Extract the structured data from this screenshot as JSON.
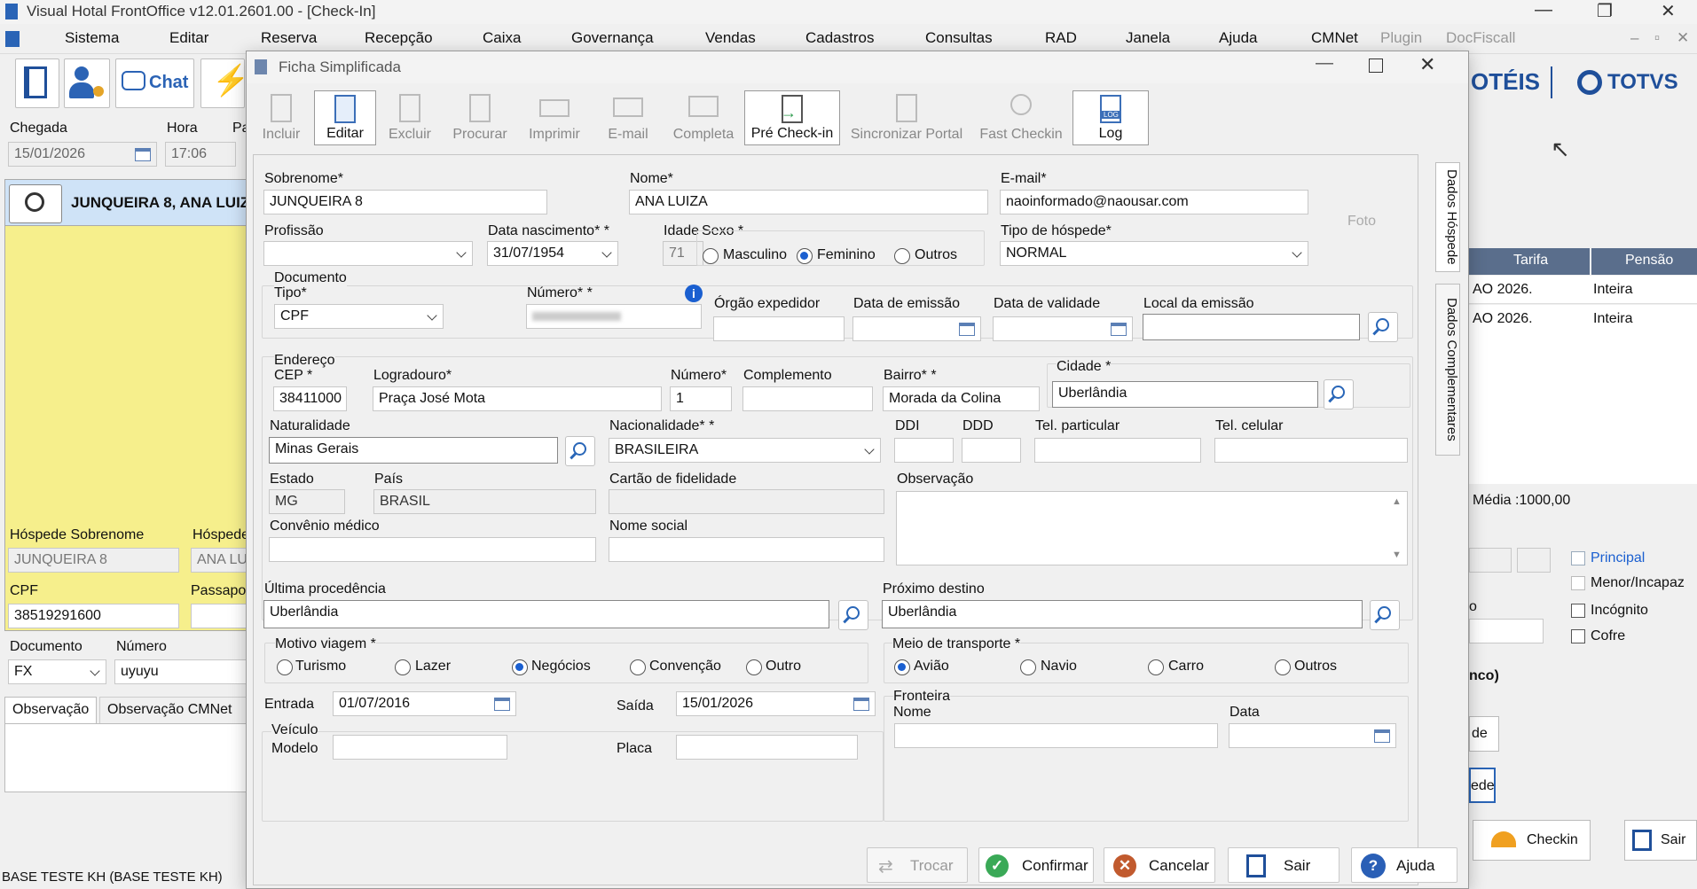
{
  "app": {
    "title": "Visual Hotal FrontOffice v12.01.2601.00 - [Check-In]",
    "controls": [
      "—",
      "❐",
      "✕"
    ]
  },
  "menu": [
    "Sistema",
    "Editar",
    "Reserva",
    "Recepção",
    "Caixa",
    "Governança",
    "Vendas",
    "Cadastros",
    "Consultas",
    "RAD",
    "Janela",
    "Ajuda",
    "CMNet",
    "Plugin",
    "DocFiscall"
  ],
  "toolbar": {
    "chat_label": "Chat"
  },
  "brand": {
    "hotels": "OTÉIS",
    "totvs": "TOTVS"
  },
  "left": {
    "chegada_label": "Chegada",
    "chegada_value": "15/01/2026",
    "hora_label": "Hora",
    "hora_value": "17:06",
    "pa_label": "Pa",
    "guest_name": "JUNQUEIRA 8, ANA LUIZA",
    "sobrenome_label": "Hóspede Sobrenome",
    "sobrenome_value": "JUNQUEIRA 8",
    "hospede_label": "Hóspede",
    "hospede_value": "ANA LU",
    "cpf_label": "CPF",
    "cpf_value": "38519291600",
    "passaporte_label": "Passapo",
    "documento_label": "Documento",
    "documento_value": "FX",
    "numero_label": "Número",
    "numero_value": "uyuyu",
    "tab_obs": "Observação",
    "tab_obs_cmnet": "Observação CMNet",
    "status": "BASE TESTE KH (BASE TESTE KH)"
  },
  "right": {
    "tarifa_header": "Tarifa",
    "pensao_header": "Pensão",
    "rows": [
      {
        "tarifa": "AO 2026.",
        "pensao": "Inteira"
      },
      {
        "tarifa": "AO 2026.",
        "pensao": "Inteira"
      }
    ],
    "media": "Média :1000,00",
    "principal": "Principal",
    "menor": "Menor/Incapaz",
    "incognito": "Incógnito",
    "cofre": "Cofre",
    "o_label": "o",
    "nco": "nco)",
    "de1": "de",
    "de2": "ede",
    "checkin": "Checkin",
    "sair": "Sair"
  },
  "dialog": {
    "title": "Ficha Simplificada",
    "ribbon": [
      "Incluir",
      "Editar",
      "Excluir",
      "Procurar",
      "Imprimir",
      "E-mail",
      "Completa",
      "Pré Check-in",
      "Sincronizar Portal",
      "Fast Checkin",
      "Log"
    ],
    "log_badge": "LOG",
    "tabs": {
      "dados_hospede": "Dados Hóspede",
      "dados_complementares": "Dados Complementares"
    },
    "foto": "Foto",
    "sobrenome": {
      "label": "Sobrenome*",
      "value": "JUNQUEIRA 8"
    },
    "nome": {
      "label": "Nome*",
      "value": "ANA LUIZA"
    },
    "email": {
      "label": "E-mail*",
      "value": "naoinformado@naousar.com"
    },
    "profissao": {
      "label": "Profissão",
      "value": ""
    },
    "nascimento": {
      "label": "Data nascimento* *",
      "value": "31/07/1954"
    },
    "idade": {
      "label": "Idade",
      "value": "71"
    },
    "sexo": {
      "label": "Sexo *",
      "options": [
        "Masculino",
        "Feminino",
        "Outros"
      ],
      "selected": "Feminino"
    },
    "tipo_hospede": {
      "label": "Tipo de hóspede*",
      "value": "NORMAL"
    },
    "documento": {
      "group": "Documento",
      "tipo_label": "Tipo*",
      "tipo_value": "CPF",
      "numero_label": "Número* *",
      "orgao_label": "Órgão expedidor",
      "emissao_label": "Data de emissão",
      "validade_label": "Data de validade",
      "local_label": "Local da emissão"
    },
    "endereco": {
      "group": "Endereço",
      "cep_label": "CEP *",
      "cep_value": "38411000",
      "logradouro_label": "Logradouro*",
      "logradouro_value": "Praça José Mota",
      "numero_label": "Número*",
      "numero_value": "1",
      "complemento_label": "Complemento",
      "bairro_label": "Bairro* *",
      "bairro_value": "Morada da Colina",
      "cidade_label": "Cidade *",
      "cidade_value": "Uberlândia",
      "naturalidade_label": "Naturalidade",
      "naturalidade_value": "Minas Gerais",
      "nacionalidade_label": "Nacionalidade* *",
      "nacionalidade_value": "BRASILEIRA",
      "ddi_label": "DDI",
      "ddd_label": "DDD",
      "tel_part_label": "Tel. particular",
      "tel_cel_label": "Tel. celular",
      "estado_label": "Estado",
      "estado_value": "MG",
      "pais_label": "País",
      "pais_value": "BRASIL",
      "fidelidade_label": "Cartão de fidelidade",
      "observacao_label": "Observação",
      "convenio_label": "Convênio médico",
      "nome_social_label": "Nome social"
    },
    "ultima_procedencia": {
      "label": "Última procedência",
      "value": "Uberlândia"
    },
    "proximo_destino": {
      "label": "Próximo destino",
      "value": "Uberlândia"
    },
    "motivo": {
      "label": "Motivo viagem *",
      "options": [
        "Turismo",
        "Lazer",
        "Negócios",
        "Convenção",
        "Outro"
      ],
      "selected": "Negócios"
    },
    "transporte": {
      "label": "Meio de transporte *",
      "options": [
        "Avião",
        "Navio",
        "Carro",
        "Outros"
      ],
      "selected": "Avião"
    },
    "entrada": {
      "label": "Entrada",
      "value": "01/07/2016"
    },
    "saida": {
      "label": "Saída",
      "value": "15/01/2026"
    },
    "veiculo": {
      "group": "Veículo",
      "modelo_label": "Modelo",
      "placa_label": "Placa"
    },
    "fronteira": {
      "group": "Fronteira",
      "nome_label": "Nome",
      "data_label": "Data"
    },
    "buttons": {
      "trocar": "Trocar",
      "confirmar": "Confirmar",
      "cancelar": "Cancelar",
      "sair": "Sair",
      "ajuda": "Ajuda"
    }
  },
  "colors": {
    "accent": "#1a5fd0",
    "highlight": "#f6ef8c",
    "selected_row": "#cfe3f7"
  }
}
